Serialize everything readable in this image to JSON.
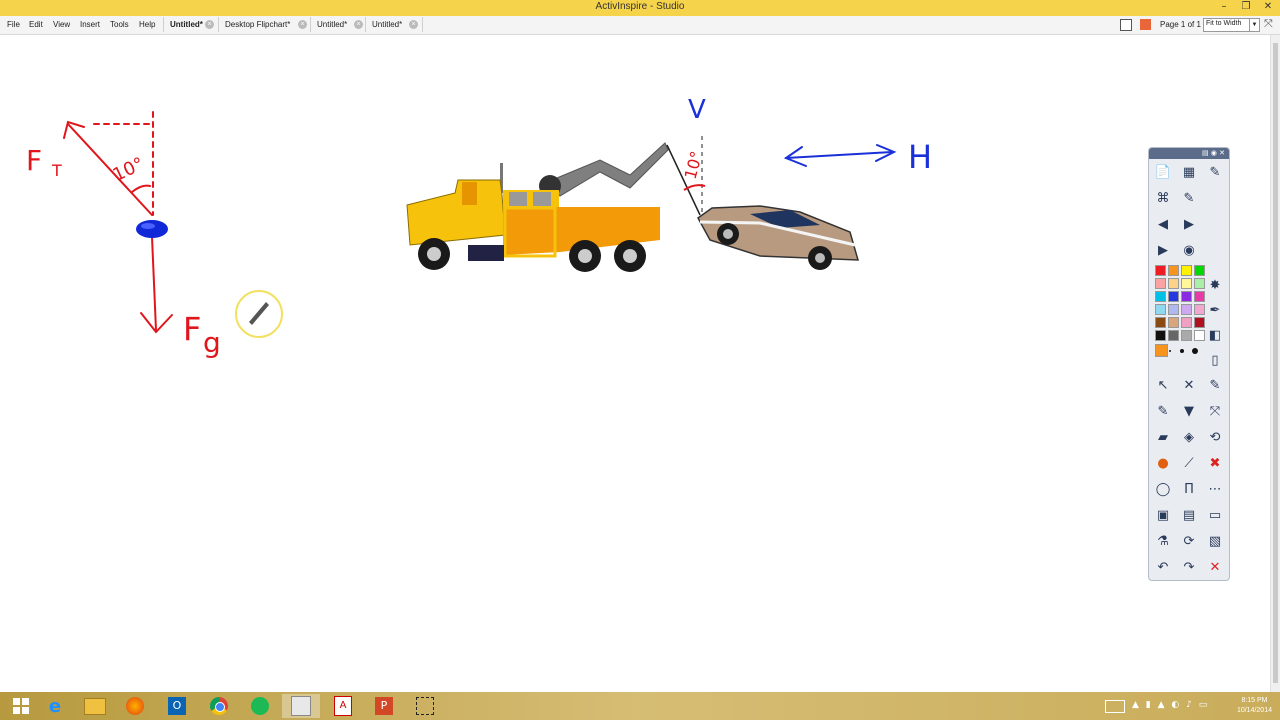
{
  "window": {
    "title": "ActivInspire - Studio"
  },
  "menu": [
    "File",
    "Edit",
    "View",
    "Insert",
    "Tools",
    "Help"
  ],
  "tabs": [
    "Untitled*",
    "Desktop Flipchart*",
    "Untitled*",
    "Untitled*"
  ],
  "page_indicator": "Page 1 of 1",
  "zoom": {
    "value": "Fit to Width"
  },
  "annotations": {
    "tension": "F",
    "tension_sub": "T",
    "angle1": "10°",
    "gravity": "F",
    "gravity_sub": "g",
    "vertical": "V",
    "horizontal": "H",
    "angle2": "10°"
  },
  "palette": [
    [
      "#ee1c24",
      "#f7941d",
      "#fff200",
      "#00d800"
    ],
    [
      "#f9a3a3",
      "#fcd289",
      "#fff799",
      "#a8f0a8"
    ],
    [
      "#00c0e8",
      "#2838e0",
      "#8a2be2",
      "#e83aa8"
    ],
    [
      "#8fd8f0",
      "#b0b8f0",
      "#d0a8f0",
      "#f0a8d0"
    ],
    [
      "#8b4a14",
      "#d9a57a",
      "#f0a0c0",
      "#b01020"
    ],
    [
      "#111111",
      "#666666",
      "#aaaaaa",
      "#ffffff"
    ]
  ],
  "clock": {
    "time": "8:15 PM",
    "date": "10/14/2014"
  }
}
